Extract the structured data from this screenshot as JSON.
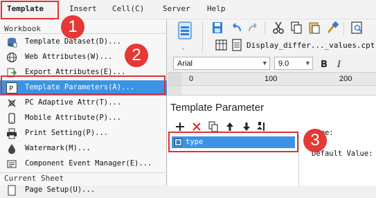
{
  "menubar": {
    "items": [
      "Template",
      "Insert",
      "Cell(C)",
      "Server",
      "Help"
    ]
  },
  "dropdown": {
    "section_workbook": "Workbook",
    "items": [
      {
        "label": "Template Dataset(D)...",
        "icon": "dataset-icon"
      },
      {
        "label": "Web Attributes(W)...",
        "icon": "globe-icon"
      },
      {
        "label": "Export Attributes(E)...",
        "icon": "export-icon"
      },
      {
        "label": "Template Parameters(A)...",
        "icon": "parameter-icon"
      },
      {
        "label": "PC Adaptive Attr(T)...",
        "icon": "pc-icon"
      },
      {
        "label": "Mobile Attribute(P)...",
        "icon": "mobile-icon"
      },
      {
        "label": "Print Setting(P)...",
        "icon": "printer-icon"
      },
      {
        "label": "Watermark(M)...",
        "icon": "watermark-icon"
      },
      {
        "label": "Component Event Manager(E)...",
        "icon": "event-manager-icon"
      }
    ],
    "section_current_sheet": "Current Sheet",
    "partial_item": "Page Setup(U)..."
  },
  "toolbar": {
    "file_tab": "Display_differ..._values.cpt *"
  },
  "font": {
    "family": "Arial",
    "size": "9.0"
  },
  "ruler": {
    "ticks": [
      "0",
      "100",
      "200"
    ]
  },
  "panel": {
    "title": "Template Parameter",
    "param": "type",
    "name_label": "Name:",
    "default_label": "Default Value:"
  },
  "annotations": {
    "badge1": "1",
    "badge2": "2",
    "badge3": "3"
  },
  "colors": {
    "selection": "#3c93e6",
    "annotation_red": "#e03030"
  }
}
